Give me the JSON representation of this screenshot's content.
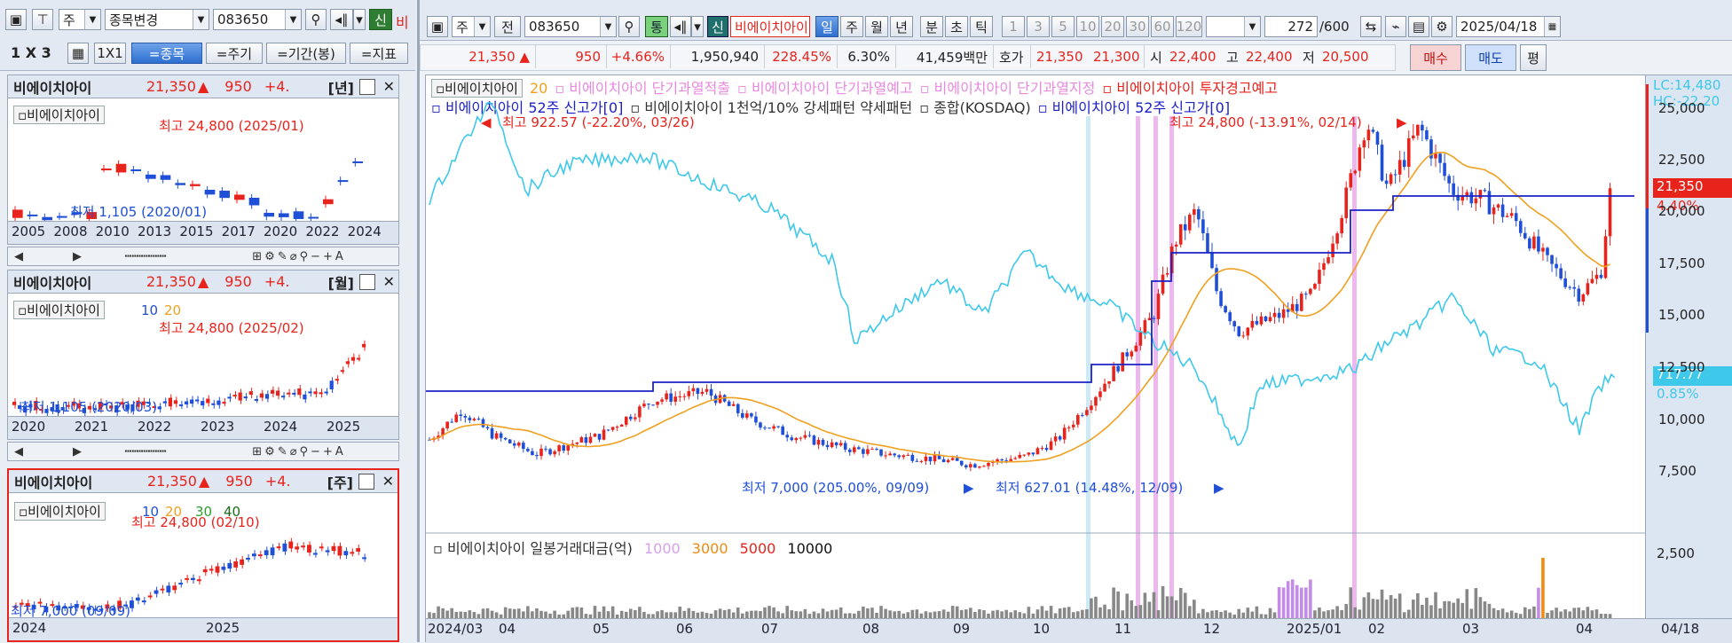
{
  "left_toolbar": {
    "period": "주",
    "mode": "종목변경",
    "code": "083650",
    "new_label": "신",
    "trail": "비",
    "layout": "1 X 3",
    "one_by_one": "1X1",
    "tabs": [
      "=종목",
      "=주기",
      "=기간(봉)",
      "=지표"
    ]
  },
  "stock": {
    "name": "비에이치아이",
    "price": "21,350",
    "up_mark": "▲",
    "change": "950",
    "pct_short": "+4.",
    "legend_name": "비에이치아이"
  },
  "mini_charts": [
    {
      "period_tag": "[년]",
      "ma": [],
      "high_label": "최고 24,800 (2025/01)",
      "low_label": "최저 1,105 (2020/01)",
      "axis": [
        "2005",
        "2008",
        "2010",
        "2013",
        "2015",
        "2017",
        "2020",
        "2022",
        "2024"
      ]
    },
    {
      "period_tag": "[월]",
      "ma": [
        "10",
        "20"
      ],
      "high_label": "최고 24,800 (2025/02)",
      "low_label": "최저 1,105 (2020/03)",
      "axis": [
        "2020",
        "2021",
        "2022",
        "2023",
        "2024",
        "2025"
      ]
    },
    {
      "period_tag": "[주]",
      "ma": [
        "10",
        "20",
        "30",
        "40"
      ],
      "high_label": "최고 24,800 (02/10)",
      "low_label": "최저 7,000 (09/09)",
      "axis": [
        "2024",
        "2025"
      ]
    }
  ],
  "main_toolbar": {
    "period": "주",
    "prev_label": "전",
    "code": "083650",
    "comm_label": "통",
    "new_label": "신",
    "name": "비에이치아이",
    "periods": [
      "일",
      "주",
      "월",
      "년",
      "분",
      "초",
      "틱"
    ],
    "numbers": [
      "1",
      "3",
      "5",
      "10",
      "20",
      "30",
      "60",
      "120"
    ],
    "count": "272",
    "max": "/600",
    "date": "2025/04/18"
  },
  "quote": {
    "price": "21,350 ▲",
    "change": "950",
    "pct": "+4.66%",
    "volume": "1,950,940",
    "vol_ratio": "228.45%",
    "turnover": "6.30%",
    "amount": "41,459백만",
    "ask_label": "호가",
    "ask1": "21,350",
    "ask2": "21,300",
    "open_label": "시",
    "open": "22,400",
    "high_label": "고",
    "high": "22,400",
    "low_label": "저",
    "low": "20,500",
    "buy": "매수",
    "sell": "매도",
    "avg": "평"
  },
  "legend": {
    "ma20": "20",
    "items": [
      "비에이치아이 단기과열적출",
      "비에이치아이 단기과열예고",
      "비에이치아이 단기과열지정",
      "비에이치아이 투자경고예고",
      "비에이치아이 52주 신고가[0]",
      "비에이치아이 1천억/10% 강세패턴  약세패턴",
      "종합(KOSDAQ)",
      "비에이치아이 52주 신고가[0]"
    ]
  },
  "annotations": {
    "high_index": "최고 922.57 (-22.20%, 03/26)",
    "high_price": "최고 24,800 (-13.91%, 02/14)",
    "low_price": "최저 7,000 (205.00%, 09/09)",
    "low_index": "최저 627.01 (14.48%, 12/09)"
  },
  "right_axis": {
    "lc": "LC:14,480",
    "hc": "HC:-22.20",
    "ticks": [
      "25,000",
      "22,500",
      "20,000",
      "17,500",
      "15,000",
      "12,500",
      "10,000",
      "7,500"
    ],
    "price_tag": "21,350",
    "pct_tag": "4.40%",
    "index_tag": "717.77",
    "index_pct": "0.85%",
    "vol_tick": "2,500",
    "last_date": "04/18"
  },
  "volume_panel": {
    "title": "비에이치아이 일봉거래대금(억)",
    "l1": "1000",
    "l2": "3000",
    "l3": "5000",
    "l4": "10000"
  },
  "date_axis": [
    "2024/03",
    "04",
    "05",
    "06",
    "07",
    "08",
    "09",
    "10",
    "11",
    "12",
    "2025/01",
    "02",
    "03",
    "04"
  ],
  "colors": {
    "up": "#e8231c",
    "down": "#1f4fd6",
    "index": "#3ec8ea",
    "ma": "#f0a020",
    "high_line": "#1c22c8",
    "alert": "#e7a6e8"
  }
}
